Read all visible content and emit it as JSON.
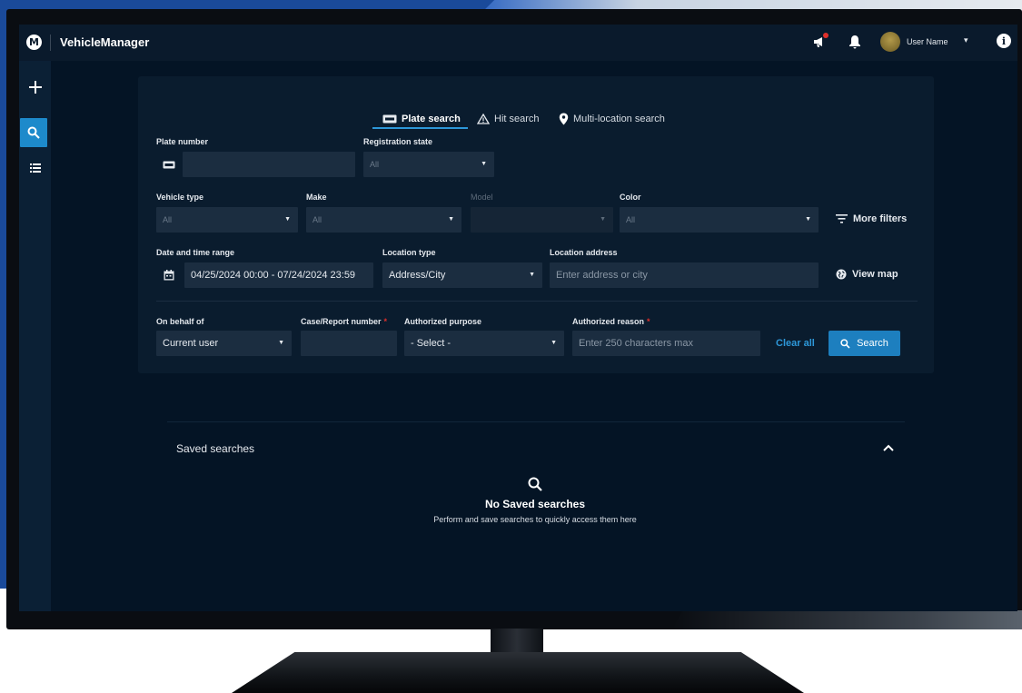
{
  "app": {
    "title": "VehicleManager",
    "logo_letter": "M"
  },
  "topbar": {
    "user_name": "User Name",
    "user_caret": "▾"
  },
  "tabs": [
    {
      "label": "Plate search",
      "icon": "plate-icon",
      "active": true
    },
    {
      "label": "Hit search",
      "icon": "warning-icon",
      "active": false
    },
    {
      "label": "Multi-location search",
      "icon": "location-pin-icon",
      "active": false
    }
  ],
  "form": {
    "plate_number": {
      "label": "Plate number",
      "value": ""
    },
    "registration_state": {
      "label": "Registration state",
      "value": "All"
    },
    "vehicle_type": {
      "label": "Vehicle type",
      "value": "All"
    },
    "make": {
      "label": "Make",
      "value": "All"
    },
    "model": {
      "label": "Model",
      "value": ""
    },
    "color": {
      "label": "Color",
      "value": "All"
    },
    "more_filters": "More filters",
    "date_range": {
      "label": "Date and time range",
      "value": "04/25/2024 00:00 - 07/24/2024 23:59"
    },
    "location_type": {
      "label": "Location type",
      "value": "Address/City"
    },
    "location_address": {
      "label": "Location address",
      "placeholder": "Enter address or city"
    },
    "view_map": "View map",
    "on_behalf_of": {
      "label": "On behalf of",
      "value": "Current user"
    },
    "case_number": {
      "label": "Case/Report number",
      "required": "*",
      "value": ""
    },
    "authorized_purpose": {
      "label": "Authorized purpose",
      "value": "- Select -"
    },
    "authorized_reason": {
      "label": "Authorized reason",
      "required": "*",
      "placeholder": "Enter 250 characters max"
    },
    "clear_all": "Clear all",
    "search": "Search"
  },
  "saved_searches": {
    "title": "Saved searches",
    "empty_title": "No Saved searches",
    "empty_subtitle": "Perform and save searches to quickly access them here"
  },
  "colors": {
    "background": "#041425",
    "panel": "#0a1c2e",
    "input": "#1b2d40",
    "accent": "#1d7fbf",
    "required": "#e0302b",
    "notification": "#e0302b"
  }
}
